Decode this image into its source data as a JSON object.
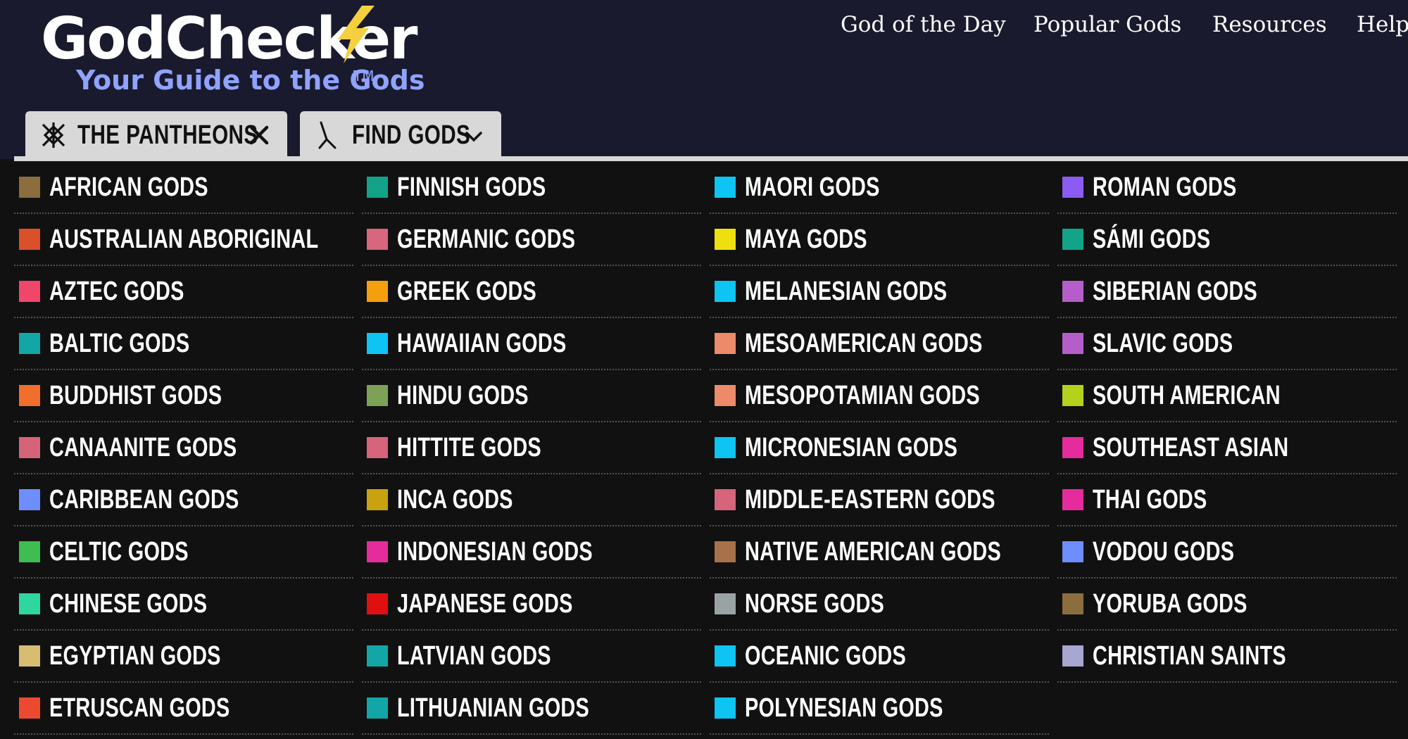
{
  "logo": {
    "title": "GodChecker",
    "subtitle": "Your Guide to the Gods",
    "trademark": "TM"
  },
  "nav": {
    "items": [
      "God of the Day",
      "Popular Gods",
      "Resources",
      "Help"
    ]
  },
  "tabs": {
    "pantheons": "THE PANTHEONS",
    "find_gods": "FIND GODS"
  },
  "colors": {
    "header": "#1a1a2e",
    "page": "#111111",
    "accent_bolt": "#f4d03f",
    "subtitle": "#8fa3ff"
  },
  "pantheons": [
    {
      "label": "AFRICAN GODS",
      "color": "#8b6d3e"
    },
    {
      "label": "AUSTRALIAN ABORIGINAL",
      "color": "#d9502a"
    },
    {
      "label": "AZTEC GODS",
      "color": "#f0466a"
    },
    {
      "label": "BALTIC GODS",
      "color": "#13a6a6"
    },
    {
      "label": "BUDDHIST GODS",
      "color": "#f06f2c"
    },
    {
      "label": "CANAANITE GODS",
      "color": "#d66478"
    },
    {
      "label": "CARIBBEAN GODS",
      "color": "#6e8eff"
    },
    {
      "label": "CELTIC GODS",
      "color": "#3dbd52"
    },
    {
      "label": "CHINESE GODS",
      "color": "#2fd6a0"
    },
    {
      "label": "EGYPTIAN GODS",
      "color": "#d6bd72"
    },
    {
      "label": "ETRUSCAN GODS",
      "color": "#ec4a30"
    },
    {
      "label": "FINNISH GODS",
      "color": "#12a389"
    },
    {
      "label": "GERMANIC GODS",
      "color": "#d8667e"
    },
    {
      "label": "GREEK GODS",
      "color": "#f4a00d"
    },
    {
      "label": "HAWAIIAN GODS",
      "color": "#0ec4f2"
    },
    {
      "label": "HINDU GODS",
      "color": "#7ea158"
    },
    {
      "label": "HITTITE GODS",
      "color": "#d6647b"
    },
    {
      "label": "INCA GODS",
      "color": "#c9a20f"
    },
    {
      "label": "INDONESIAN GODS",
      "color": "#e62c9c"
    },
    {
      "label": "JAPANESE GODS",
      "color": "#e01010"
    },
    {
      "label": "LATVIAN GODS",
      "color": "#13a6a6"
    },
    {
      "label": "LITHUANIAN GODS",
      "color": "#13a6a6"
    },
    {
      "label": "MAORI GODS",
      "color": "#0ec4f2"
    },
    {
      "label": "MAYA GODS",
      "color": "#eee00e"
    },
    {
      "label": "MELANESIAN GODS",
      "color": "#0ec4f2"
    },
    {
      "label": "MESOAMERICAN GODS",
      "color": "#ec8a6a"
    },
    {
      "label": "MESOPOTAMIAN GODS",
      "color": "#ec8a6a"
    },
    {
      "label": "MICRONESIAN GODS",
      "color": "#0ec4f2"
    },
    {
      "label": "MIDDLE-EASTERN GODS",
      "color": "#d6647b"
    },
    {
      "label": "NATIVE AMERICAN GODS",
      "color": "#a8714a"
    },
    {
      "label": "NORSE GODS",
      "color": "#9aa3a3"
    },
    {
      "label": "OCEANIC GODS",
      "color": "#0ec4f2"
    },
    {
      "label": "POLYNESIAN GODS",
      "color": "#0ec4f2"
    },
    {
      "label": "ROMAN GODS",
      "color": "#8a5cf2"
    },
    {
      "label": "SÁMI GODS",
      "color": "#12a389"
    },
    {
      "label": "SIBERIAN GODS",
      "color": "#b55ec9"
    },
    {
      "label": "SLAVIC GODS",
      "color": "#b55ec9"
    },
    {
      "label": "SOUTH AMERICAN",
      "color": "#b4d21c"
    },
    {
      "label": "SOUTHEAST ASIAN",
      "color": "#e62c9c"
    },
    {
      "label": "THAI GODS",
      "color": "#e62c9c"
    },
    {
      "label": "VODOU GODS",
      "color": "#6e8eff"
    },
    {
      "label": "YORUBA GODS",
      "color": "#8b6d3e"
    },
    {
      "label": "CHRISTIAN SAINTS",
      "color": "#a7a7d1"
    }
  ]
}
